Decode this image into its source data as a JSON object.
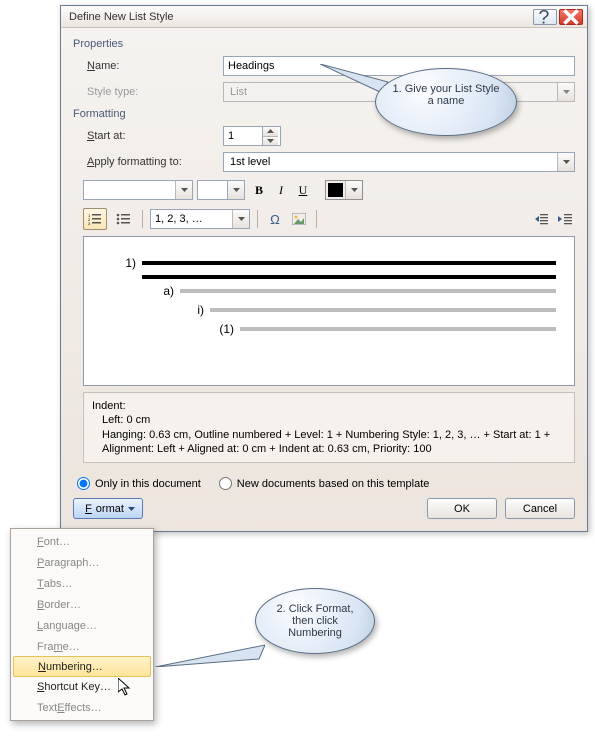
{
  "titlebar": {
    "title": "Define New List Style"
  },
  "sections": {
    "properties": "Properties",
    "formatting": "Formatting"
  },
  "labels": {
    "name": "Name:",
    "name_u": "N",
    "style_type": "Style type:",
    "start_at": "Start at:",
    "start_at_u": "S",
    "apply_to": "Apply formatting to:",
    "apply_to_u": "A"
  },
  "fields": {
    "name_value": "Headings",
    "style_type_value": "List",
    "start_at_value": "1",
    "apply_to_value": "1st level",
    "number_style_value": "1, 2, 3, …"
  },
  "preview": {
    "l1": "1)",
    "l2": "a)",
    "l3": "i)",
    "l4": "(1)"
  },
  "description": {
    "h": "Indent:",
    "line1": "Left:  0 cm",
    "line2": "Hanging:  0.63 cm, Outline numbered + Level: 1 + Numbering Style: 1, 2, 3, … + Start at: 1 + Alignment: Left + Aligned at:  0 cm + Indent at:  0.63 cm, Priority: 100"
  },
  "radios": {
    "only_doc": "Only in this document",
    "new_docs": "New documents based on this template"
  },
  "buttons": {
    "format": "Format",
    "ok": "OK",
    "cancel": "Cancel"
  },
  "menu": {
    "font": "Font…",
    "paragraph": "Paragraph…",
    "tabs": "Tabs…",
    "border": "Border…",
    "language": "Language…",
    "frame": "Frame…",
    "numbering": "Numbering…",
    "shortcut": "Shortcut Key…",
    "effects": "Text Effects…"
  },
  "callouts": {
    "c1": "1. Give your List Style a name",
    "c2": "2. Click Format, then click Numbering"
  }
}
